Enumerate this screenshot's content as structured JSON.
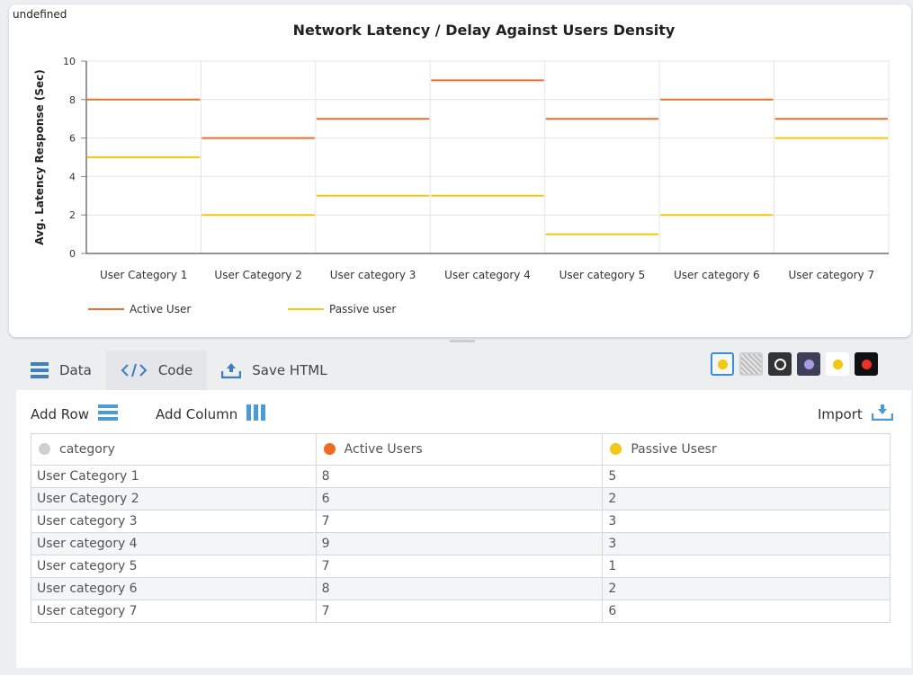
{
  "undefined_label": "undefined",
  "chart_data": {
    "type": "line",
    "title": "Network Latency / Delay Against Users Density",
    "ylabel": "Avg. Latency Response (Sec)",
    "xlabel": "",
    "ylim": [
      0,
      10
    ],
    "yticks": [
      0,
      2,
      4,
      6,
      8,
      10
    ],
    "grid": true,
    "step": true,
    "legend_position": "bottom-left",
    "categories": [
      "User Category 1",
      "User Category 2",
      "User category 3",
      "User category 4",
      "User category 5",
      "User category 6",
      "User category 7"
    ],
    "series": [
      {
        "name": "Active User",
        "values": [
          8,
          6,
          7,
          9,
          7,
          8,
          7
        ],
        "color": "#e8702a"
      },
      {
        "name": "Passive user",
        "values": [
          5,
          2,
          3,
          3,
          1,
          2,
          6
        ],
        "color": "#f2c811"
      }
    ]
  },
  "tabs": [
    {
      "label": "Data",
      "icon": "table-icon"
    },
    {
      "label": "Code",
      "icon": "code-icon"
    },
    {
      "label": "Save HTML",
      "icon": "upload-icon"
    }
  ],
  "toolbar": {
    "add_row": "Add Row",
    "add_column": "Add Column",
    "import": "Import"
  },
  "table": {
    "headers": [
      "category",
      "Active Users",
      "Passive Usesr"
    ],
    "header_colors": [
      "#c8c8c8",
      "#f06a1f",
      "#f5c518"
    ],
    "rows": [
      [
        "User Category 1",
        "8",
        "5"
      ],
      [
        "User Category 2",
        "6",
        "2"
      ],
      [
        "User category 3",
        "7",
        "3"
      ],
      [
        "User category 4",
        "9",
        "3"
      ],
      [
        "User category 5",
        "7",
        "1"
      ],
      [
        "User category 6",
        "8",
        "2"
      ],
      [
        "User category 7",
        "7",
        "6"
      ]
    ]
  },
  "themes": [
    {
      "name": "theme-yellow-swatch",
      "bg": "#f4f6f8",
      "dot": "#f2c811",
      "border": "#3b8fd9"
    },
    {
      "name": "theme-pattern-swatch",
      "bg": "#cfcfcf",
      "dot": "",
      "border": "#cfcfcf"
    },
    {
      "name": "theme-ring-swatch",
      "bg": "#333",
      "dot": "#ffffff",
      "border": "#333"
    },
    {
      "name": "theme-purple-swatch",
      "bg": "#3c3f55",
      "dot": "#a999e6",
      "border": "#3c3f55"
    },
    {
      "name": "theme-light-swatch",
      "bg": "#ffffff",
      "dot": "#f2c811",
      "border": "#ffffff"
    },
    {
      "name": "theme-red-swatch",
      "bg": "#111111",
      "dot": "#e8322a",
      "border": "#111111"
    }
  ]
}
